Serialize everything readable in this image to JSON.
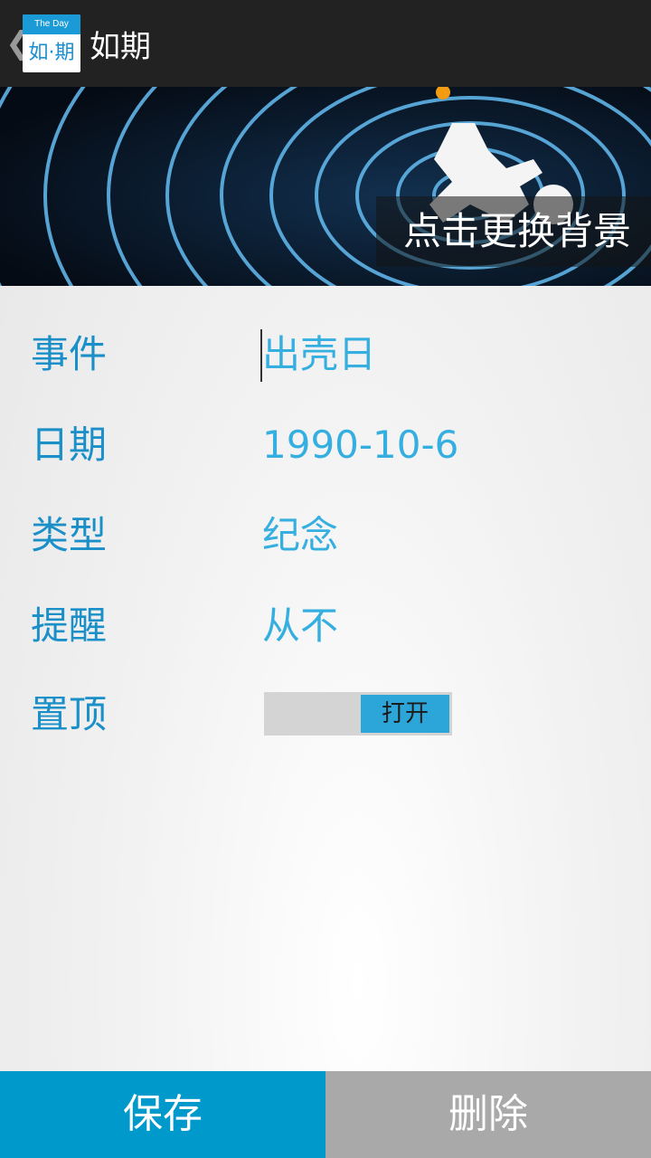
{
  "actionbar": {
    "back_glyph": "❮",
    "logo_top": "The Day",
    "logo_bottom": "如·期",
    "title": "如期"
  },
  "banner": {
    "change_background_label": "点击更换背景"
  },
  "form": {
    "event": {
      "label": "事件",
      "value": "出壳日"
    },
    "date": {
      "label": "日期",
      "value": "1990-10-6"
    },
    "type": {
      "label": "类型",
      "value": "纪念"
    },
    "reminder": {
      "label": "提醒",
      "value": "从不"
    },
    "pin": {
      "label": "置顶",
      "toggle_label": "打开"
    }
  },
  "buttons": {
    "save": "保存",
    "delete": "删除"
  },
  "colors": {
    "accent": "#0099cc",
    "label": "#1a8fc8",
    "value": "#35aee0",
    "delete": "#a9a9a9"
  }
}
